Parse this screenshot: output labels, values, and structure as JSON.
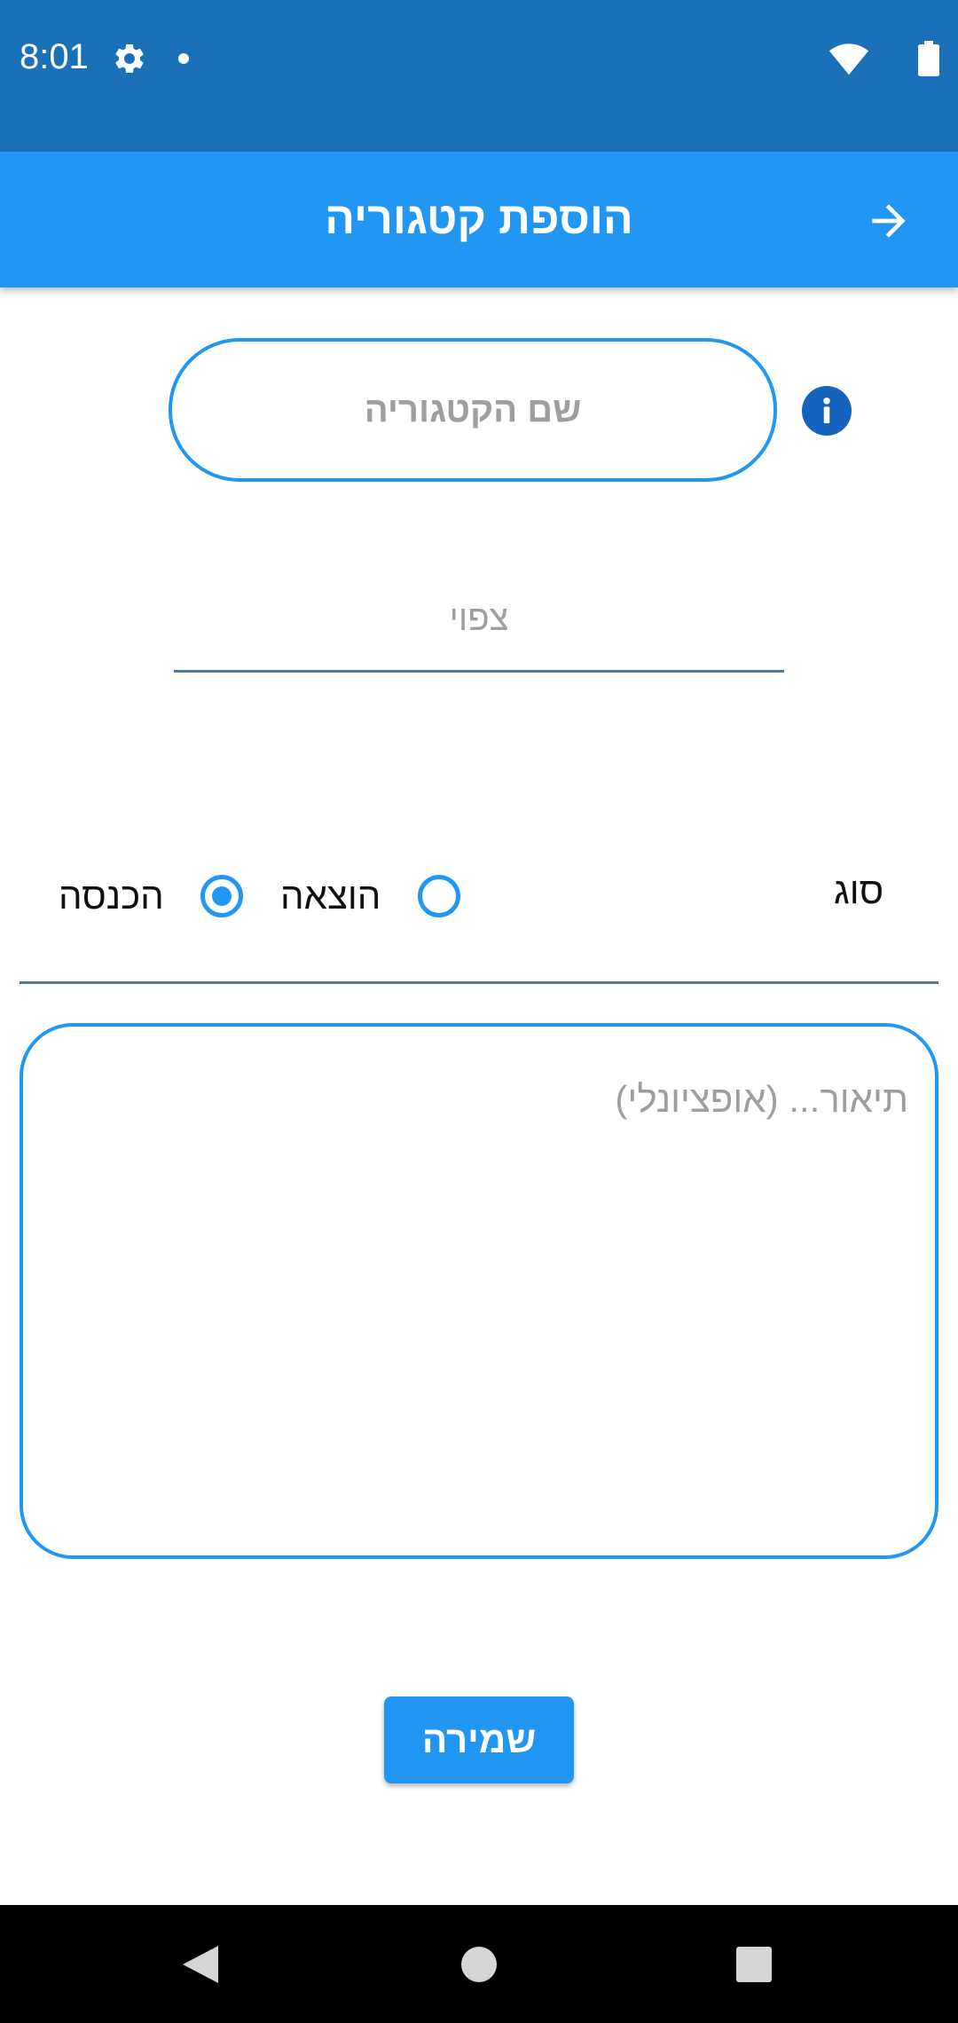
{
  "status_bar": {
    "time": "8:01",
    "icons": [
      "gear-icon",
      "notification-dot-icon",
      "wifi-icon",
      "battery-icon"
    ]
  },
  "app_bar": {
    "title": "הוספת קטגוריה",
    "back_icon": "arrow-right-icon"
  },
  "form": {
    "category_name": {
      "placeholder": "שם הקטגוריה",
      "value": ""
    },
    "info_icon": "info-icon",
    "expected": {
      "placeholder": "צפוי",
      "value": ""
    },
    "type": {
      "label": "סוג",
      "options": [
        {
          "label": "הוצאה",
          "selected": false
        },
        {
          "label": "הכנסה",
          "selected": true
        }
      ]
    },
    "description": {
      "placeholder": "תיאור... (אופציונלי)",
      "value": ""
    },
    "save_label": "שמירה"
  },
  "nav_bar": {
    "icons": [
      "back-triangle-icon",
      "home-circle-icon",
      "recents-square-icon"
    ]
  },
  "colors": {
    "status_bar": "#1b71b8",
    "primary": "#2196f3",
    "info": "#1565c0",
    "underline": "#4f7a97",
    "placeholder": "#9e9e9e"
  }
}
